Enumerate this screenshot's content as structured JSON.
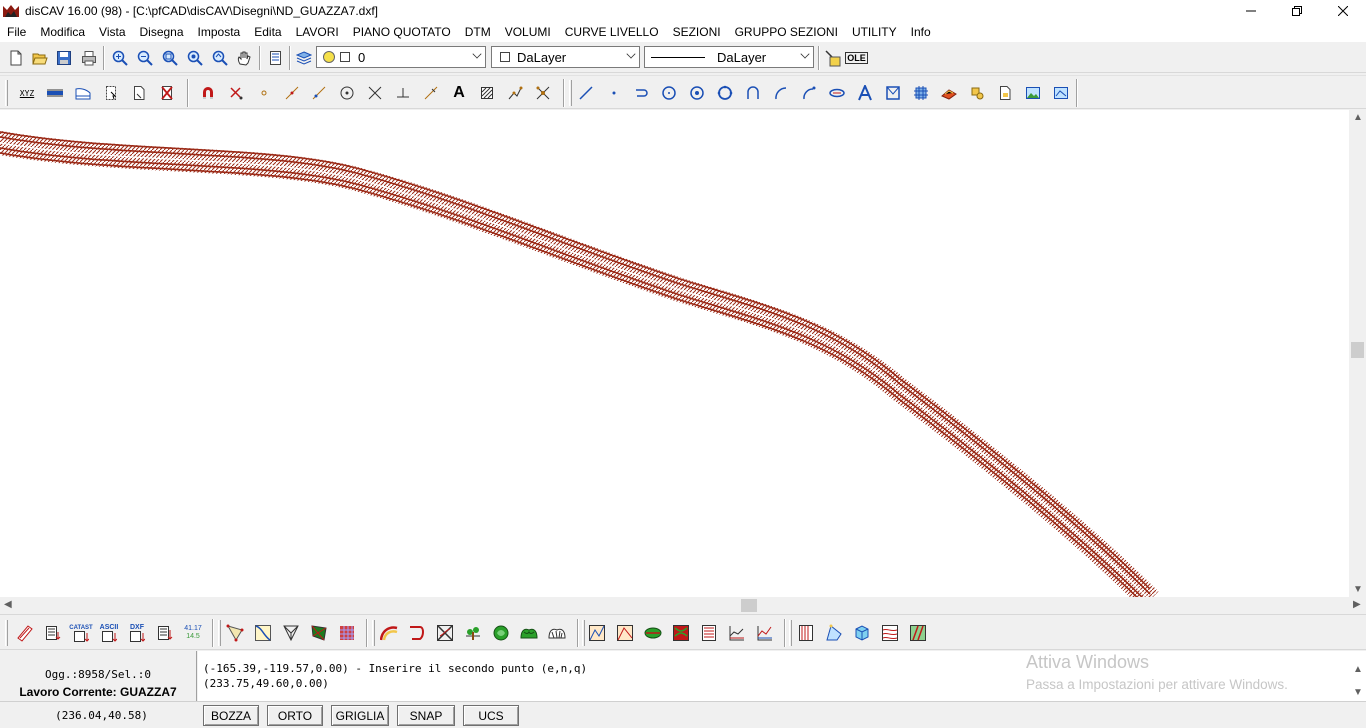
{
  "window": {
    "title": "disCAV 16.00 (98) - [C:\\pfCAD\\disCAV\\Disegni\\ND_GUAZZA7.dxf]",
    "controls": [
      "minimize-icon",
      "restore-icon",
      "close-icon"
    ]
  },
  "menu": [
    "File",
    "Modifica",
    "Vista",
    "Disegna",
    "Imposta",
    "Edita",
    "LAVORI",
    "PIANO QUOTATO",
    "DTM",
    "VOLUMI",
    "CURVE LIVELLO",
    "SEZIONI",
    "GRUPPO SEZIONI",
    "UTILITY",
    "Info"
  ],
  "toolbar1": {
    "layer_value": "0",
    "color_value": "DaLayer",
    "linetype_value": "DaLayer",
    "ole_label": "OLE"
  },
  "toolbar2": {
    "xyz_label": "XYZ",
    "text_tool_label": "A"
  },
  "toolbar3": {
    "catast_label": "CATAST",
    "ascii_label": "ASCII",
    "dxf_label": "DXF",
    "num_label_top": "41.17",
    "num_label_bottom": "14.5"
  },
  "info": {
    "objects": "Ogg.:8958/Sel.:0",
    "current_work": "Lavoro Corrente: GUAZZA7"
  },
  "command": {
    "line1": "(-165.39,-119.57,0.00) - Inserire il secondo punto (e,n,q)",
    "line2": "(233.75,49.60,0.00)",
    "watermark_title": "Attiva Windows",
    "watermark_sub": "Passa a Impostazioni per attivare Windows."
  },
  "status": {
    "coords": "(236.04,40.58)",
    "buttons": [
      "BOZZA",
      "ORTO",
      "GRIGLIA",
      "SNAP",
      "UCS"
    ]
  },
  "colors": {
    "road_stroke": "#9b2a17",
    "icon_blue": "#1a4fb5",
    "icon_red": "#c01818"
  }
}
